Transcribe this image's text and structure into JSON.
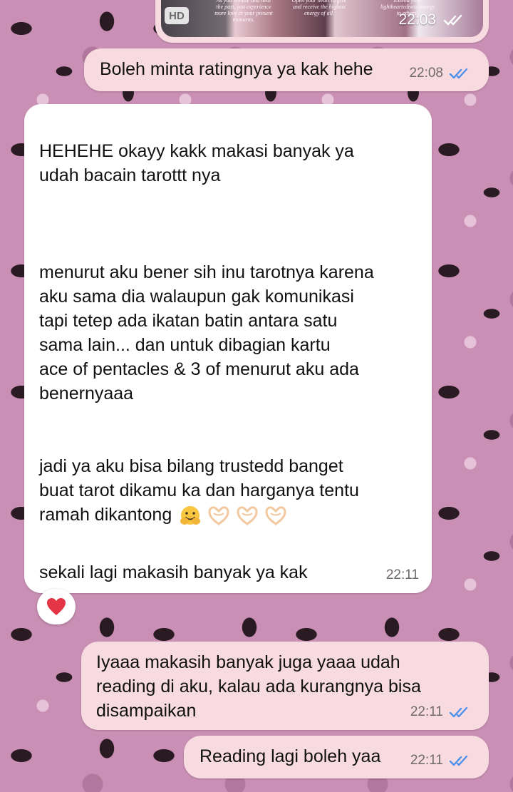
{
  "colors": {
    "outgoing_bubble": "#f8dbe0",
    "incoming_bubble": "#ffffff",
    "read_tick": "#4f8fe8",
    "background": "#c98fb4"
  },
  "media": {
    "hd_label": "HD",
    "time": "22:03",
    "card_texts": [
      "As you release and heal the past, you experience more love in your present moments.",
      "Open your heart to give and receive the highest energy of all.",
      "Extend your lightheartedness energy to others!"
    ]
  },
  "messages": [
    {
      "text": "Boleh minta ratingnya ya kak hehe",
      "time": "22:08"
    },
    {
      "text": "HEHEHE okayy kakk makasi banyak ya\nudah bacain tarottt nya\n\n\n\nmenurut aku bener sih inu tarotnya karena\naku sama dia walaupun gak komunikasi\ntapi tetep ada ikatan batin antara satu\nsama lain... dan untuk dibagian kartu\nace of pentacles & 3 of menurut aku ada\nbenernyaaa\n\n\njadi ya aku bisa bilang trustedd banget\nbuat tarot dikamu ka dan harganya tentu\nramah dikantong",
      "text_end": "sekali lagi makasih banyak ya kak",
      "time": "22:11"
    },
    {
      "text": "Iyaaa makasih banyak juga yaaa udah\nreading di aku, kalau ada kurangnya bisa\ndisampaikan",
      "time": "22:11"
    },
    {
      "text": "Reading lagi boleh yaa",
      "time": "22:11"
    }
  ],
  "reaction": {
    "icon": "red-heart-icon"
  },
  "emojis": [
    "hugging-face-icon",
    "heart-hands-icon",
    "heart-hands-icon",
    "heart-hands-icon"
  ]
}
